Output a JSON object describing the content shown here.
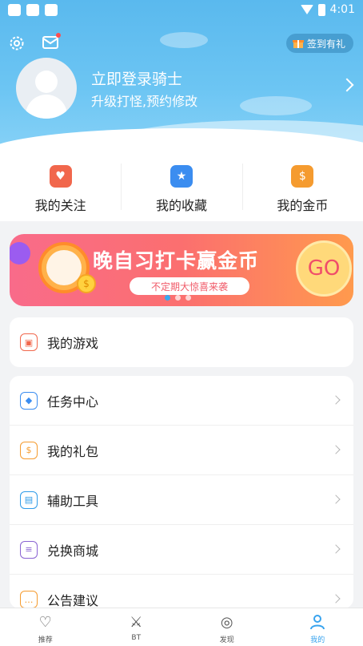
{
  "statusbar": {
    "time": "4:01"
  },
  "header": {
    "signin_label": "签到有礼",
    "login_title": "立即登录骑士",
    "login_subtitle": "升级打怪,预约修改"
  },
  "quick_actions": [
    {
      "label": "我的关注",
      "icon": "heart-icon",
      "color": "#f1674c"
    },
    {
      "label": "我的收藏",
      "icon": "star-icon",
      "color": "#3b8df0"
    },
    {
      "label": "我的金币",
      "icon": "coin-icon",
      "color": "#f59b2f"
    }
  ],
  "banner": {
    "title": "晚自习打卡赢金币",
    "subtitle": "不定期大惊喜来袭",
    "go": "GO",
    "coin_symbol": "$"
  },
  "games_card": {
    "label": "我的游戏",
    "color": "#f1674c"
  },
  "menu": [
    {
      "label": "任务中心",
      "icon": "diamond-icon",
      "color": "#3b8df0"
    },
    {
      "label": "我的礼包",
      "icon": "gift-bag-icon",
      "color": "#f59b2f"
    },
    {
      "label": "辅助工具",
      "icon": "toolbox-icon",
      "color": "#2f9be8"
    },
    {
      "label": "兑换商城",
      "icon": "shop-icon",
      "color": "#8a63d2"
    },
    {
      "label": "公告建议",
      "icon": "notice-icon",
      "color": "#f59b2f"
    }
  ],
  "nav": [
    {
      "label": "推荐",
      "icon": "heart-outline-icon",
      "active": false
    },
    {
      "label": "BT",
      "icon": "sword-icon",
      "active": false
    },
    {
      "label": "发现",
      "icon": "planet-icon",
      "active": false
    },
    {
      "label": "我的",
      "icon": "user-icon",
      "active": true
    }
  ],
  "colors": {
    "accent": "#38a3ee",
    "header_blue": "#5ab9ee"
  }
}
